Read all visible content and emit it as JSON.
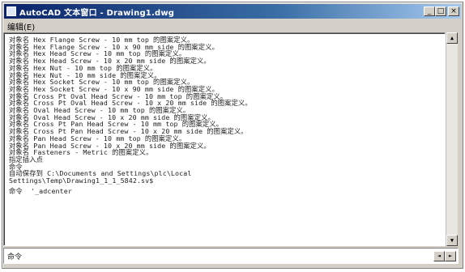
{
  "window": {
    "title": "AutoCAD 文本窗口 - Drawing1.dwg",
    "buttons": {
      "minimize": "_",
      "maximize": "□",
      "close": "×"
    }
  },
  "menu": {
    "edit": "编辑(E)"
  },
  "console": {
    "lines": [
      "对象名 Hex Flange Screw - 10 mm top 的图案定义。",
      "对象名 Hex Flange Screw - 10 x 90 mm side 的图案定义。",
      "对象名 Hex Head Screw - 10 mm top 的图案定义。",
      "对象名 Hex Head Screw - 10 x 20 mm side 的图案定义。",
      "对象名 Hex Nut - 10 mm top 的图案定义。",
      "对象名 Hex Nut - 10 mm side 的图案定义。",
      "对象名 Hex Socket Screw - 10 mm top 的图案定义。",
      "对象名 Hex Socket Screw - 10 x 90 mm side 的图案定义。",
      "对象名 Cross Pt Oval Head Screw - 10 mm top 的图案定义。",
      "对象名 Cross Pt Oval Head Screw - 10 x 20 mm side 的图案定义。",
      "对象名 Oval Head Screw - 10 mm top 的图案定义。",
      "对象名 Oval Head Screw - 10 x 20 mm side 的图案定义。",
      "对象名 Cross Pt Pan Head Screw - 10 mm top 的图案定义。",
      "对象名 Cross Pt Pan Head Screw - 10 x 20 mm side 的图案定义。",
      "对象名 Pan Head Screw - 10 mm top 的图案定义。",
      "对象名 Pan Head Screw - 10 x 20 mm side 的图案定义。",
      "对象名 Fasteners - Metric 的图案定义。",
      "指定插入点",
      "命令",
      "自动保存到 C:\\Documents and Settings\\plc\\Local",
      "Settings\\Temp\\Drawing1_1_1_5842.sv$",
      "命令  '_adcenter"
    ]
  },
  "status": {
    "prompt": "命令"
  },
  "scroll": {
    "up": "▲",
    "down": "▼",
    "left": "◄",
    "right": "►"
  }
}
